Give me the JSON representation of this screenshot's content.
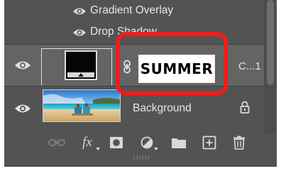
{
  "effects": [
    {
      "label": "Gradient Overlay"
    },
    {
      "label": "Drop Shadow"
    }
  ],
  "layers": [
    {
      "kind": "fill-with-mask",
      "mask_text": "SUMMER",
      "name_truncated": "C...1",
      "selected": true
    },
    {
      "kind": "image",
      "name": "Background",
      "locked": true
    }
  ],
  "toolbar": {
    "fx_label": "fx"
  },
  "colors": {
    "panel_bg": "#535353",
    "selected_row": "#646464",
    "highlight": "#ee1c1c"
  }
}
